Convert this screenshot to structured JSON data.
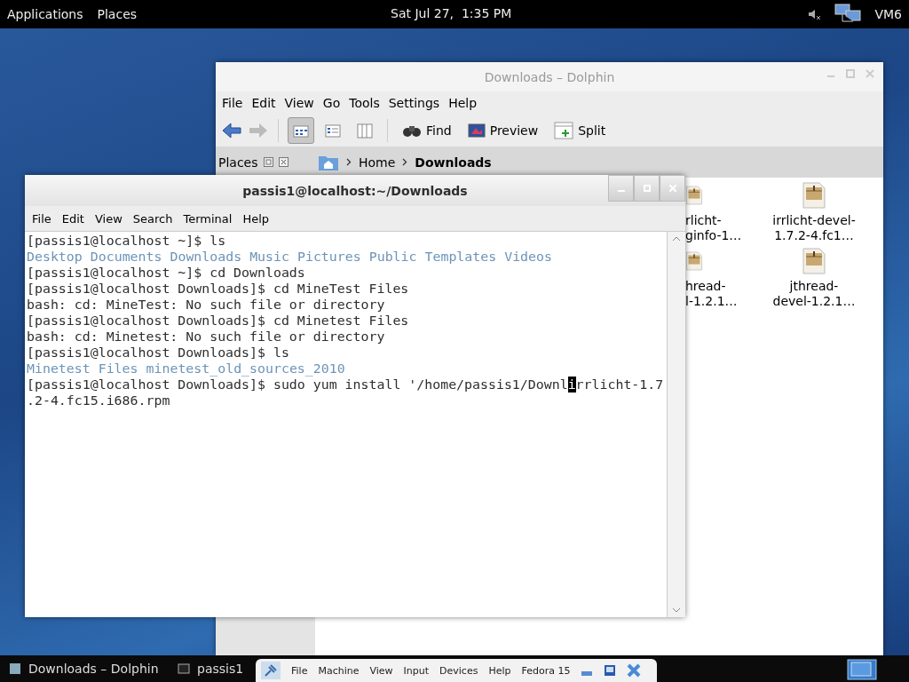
{
  "top_bar": {
    "menus": [
      "Applications",
      "Places"
    ],
    "clock": "Sat Jul 27,  1:35 PM",
    "user": "VM6"
  },
  "dolphin": {
    "title": "Downloads – Dolphin",
    "menu": [
      "File",
      "Edit",
      "View",
      "Go",
      "Tools",
      "Settings",
      "Help"
    ],
    "views": [
      {
        "kind": "icons",
        "selected": true
      },
      {
        "kind": "details",
        "selected": false
      },
      {
        "kind": "columns",
        "selected": false
      }
    ],
    "tools": [
      {
        "kind": "find",
        "label": "Find"
      },
      {
        "kind": "preview",
        "label": "Preview"
      },
      {
        "kind": "split",
        "label": "Split"
      }
    ],
    "places_title": "Places",
    "breadcrumb": [
      "Home",
      "Downloads"
    ],
    "files": [
      {
        "lines": [
          "rlicht-",
          "ginfo-1…"
        ]
      },
      {
        "lines": [
          "irrlicht-devel-",
          "1.7.2-4.fc1…"
        ]
      },
      {
        "lines": [
          "hread-",
          "l-1.2.1…"
        ]
      },
      {
        "lines": [
          "jthread-",
          "devel-1.2.1…"
        ]
      }
    ]
  },
  "terminal": {
    "title": "passis1@localhost:~/Downloads",
    "menu": [
      "File",
      "Edit",
      "View",
      "Search",
      "Terminal",
      "Help"
    ],
    "lines": [
      {
        "kind": "text",
        "text": "[passis1@localhost ~]$ ls"
      },
      {
        "kind": "dirs",
        "items": [
          "Desktop",
          "Documents",
          "Downloads",
          "Music",
          "Pictures",
          "Public",
          "Templates",
          "Videos"
        ]
      },
      {
        "kind": "text",
        "text": "[passis1@localhost ~]$ cd Downloads"
      },
      {
        "kind": "text",
        "text": "[passis1@localhost Downloads]$ cd MineTest Files"
      },
      {
        "kind": "text",
        "text": "bash: cd: MineTest: No such file or directory"
      },
      {
        "kind": "text",
        "text": "[passis1@localhost Downloads]$ cd Minetest Files"
      },
      {
        "kind": "text",
        "text": "bash: cd: Minetest: No such file or directory"
      },
      {
        "kind": "text",
        "text": "[passis1@localhost Downloads]$ ls"
      },
      {
        "kind": "dirs",
        "items": [
          "Minetest Files",
          "minetest_old_sources_2010"
        ]
      },
      {
        "kind": "cursor",
        "before": "[passis1@localhost Downloads]$ sudo yum install '/home/passis1/Downl",
        "cursor": "i",
        "after": "rrlicht-1.7"
      },
      {
        "kind": "text",
        "text": ".2-4.fc15.i686.rpm"
      }
    ]
  },
  "taskbar": {
    "tasks": [
      {
        "kind": "folder",
        "label": "Downloads – Dolphin"
      },
      {
        "kind": "terminal",
        "label": "passis1"
      }
    ],
    "vbox_menu": [
      "File",
      "Machine",
      "View",
      "Input",
      "Devices",
      "Help"
    ],
    "vbox_label": "Fedora 15"
  }
}
